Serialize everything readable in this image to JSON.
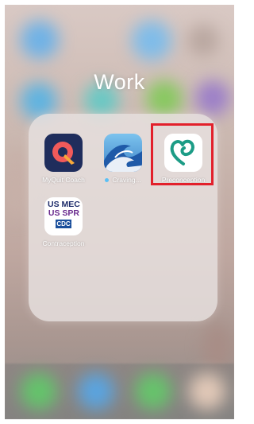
{
  "folder": {
    "title": "Work"
  },
  "apps": [
    {
      "label": "MyQuit Coach",
      "icon": "myquit-coach-icon"
    },
    {
      "label": "Craving...",
      "icon": "craving-wave-icon",
      "new_indicator": true
    },
    {
      "label": "Preconception",
      "icon": "preconception-heart-icon",
      "highlighted": true
    },
    {
      "label": "Contraception",
      "icon": "contraception-cdc-icon",
      "icon_text": {
        "line1": "US MEC",
        "line2": "US SPR",
        "badge": "CDC"
      }
    }
  ],
  "colors": {
    "highlight": "#e2202b",
    "new_dot": "#5bc0f5",
    "myquit_bg": "#1f2d5c",
    "craving_bg": "#3f84c8",
    "preconception_fg": "#1c9c86"
  }
}
